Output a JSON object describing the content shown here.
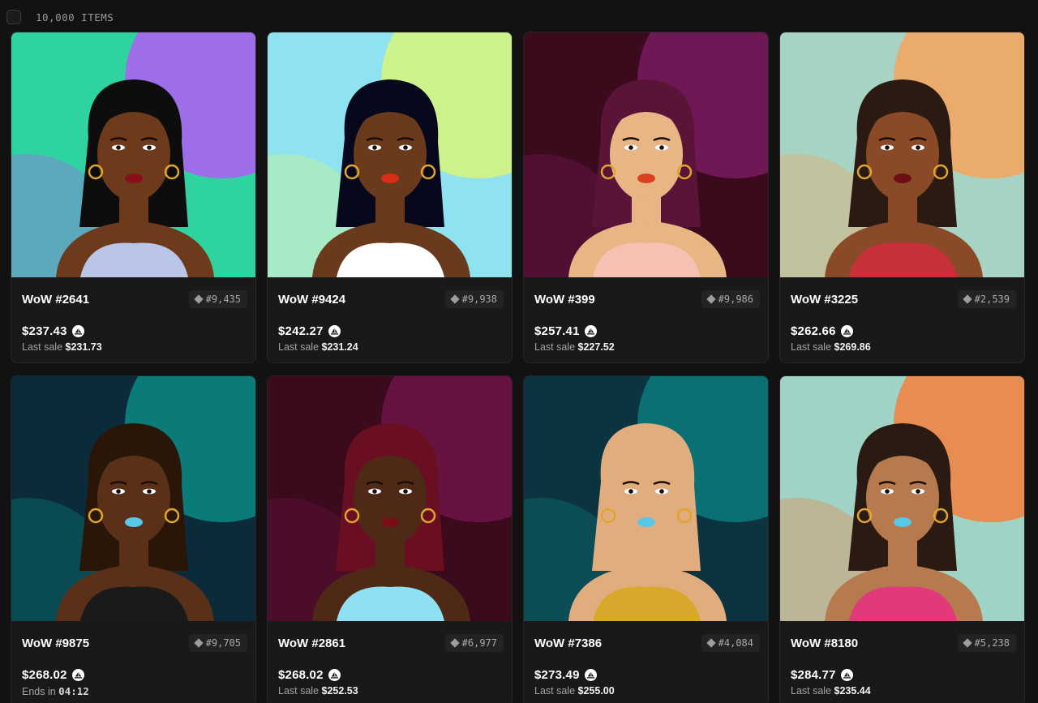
{
  "header": {
    "items_count": "10,000 ITEMS"
  },
  "cards": [
    {
      "name": "WoW #2641",
      "rank": "#9,435",
      "price": "$237.43",
      "sub_label": "Last sale",
      "sub_value": "$231.73",
      "coin": "opensea-coin-icon",
      "bg1": "#2fd3a0",
      "bg2": "#b25cf7",
      "skin": "#6e3a1c",
      "hair": "#0d0d0d",
      "top": "#b9c6e8",
      "lips": "#8a0f1c"
    },
    {
      "name": "WoW #9424",
      "rank": "#9,938",
      "price": "$242.27",
      "sub_label": "Last sale",
      "sub_value": "$231.24",
      "coin": "opensea-coin-icon",
      "bg1": "#8fe2ef",
      "bg2": "#d8f57a",
      "skin": "#6a3a1d",
      "hair": "#07081c",
      "top": "#ffffff",
      "lips": "#d92e1a"
    },
    {
      "name": "WoW #399",
      "rank": "#9,986",
      "price": "$257.41",
      "sub_label": "Last sale",
      "sub_value": "$227.52",
      "coin": "opensea-coin-icon",
      "bg1": "#3b0a1c",
      "bg2": "#7a1b60",
      "skin": "#e8b584",
      "hair": "#5a1438",
      "top": "#f6c1b3",
      "lips": "#d8421e"
    },
    {
      "name": "WoW #3225",
      "rank": "#2,539",
      "price": "$262.66",
      "sub_label": "Last sale",
      "sub_value": "$269.86",
      "coin": "opensea-coin-icon",
      "bg1": "#a6d3c4",
      "bg2": "#f6a35d",
      "skin": "#8a4a28",
      "hair": "#2a1a12",
      "top": "#c8313a",
      "lips": "#6e0d16"
    },
    {
      "name": "WoW #9875",
      "rank": "#9,705",
      "price": "$268.02",
      "sub_label": "Ends in",
      "sub_value": "04:12",
      "coin": "opensea-coin-icon",
      "bg1": "#0b2a3a",
      "bg2": "#0a8a84",
      "skin": "#5a3018",
      "hair": "#2a1608",
      "top": "#1a1a1a",
      "lips": "#58c8e8"
    },
    {
      "name": "WoW #2861",
      "rank": "#6,977",
      "price": "$268.02",
      "sub_label": "Last sale",
      "sub_value": "$252.53",
      "coin": "opensea-coin-icon",
      "bg1": "#3b0a1c",
      "bg2": "#6e1548",
      "skin": "#4e2a16",
      "hair": "#6a0e22",
      "top": "#8fe0f2",
      "lips": "#7a0e18"
    },
    {
      "name": "WoW #7386",
      "rank": "#4,084",
      "price": "$273.49",
      "sub_label": "Last sale",
      "sub_value": "$255.00",
      "coin": "opensea-coin-icon",
      "bg1": "#0c3340",
      "bg2": "#0b7b7e",
      "skin": "#e2ad7e",
      "hair": "#e2ad7e",
      "top": "#d9a82a",
      "lips": "#58c8e8"
    },
    {
      "name": "WoW #8180",
      "rank": "#5,238",
      "price": "$284.77",
      "sub_label": "Last sale",
      "sub_value": "$235.44",
      "coin": "opensea-coin-icon",
      "bg1": "#9fd3c6",
      "bg2": "#f47f3c",
      "skin": "#b67a4e",
      "hair": "#2a1a12",
      "top": "#e03a7a",
      "lips": "#58c8e8"
    }
  ]
}
